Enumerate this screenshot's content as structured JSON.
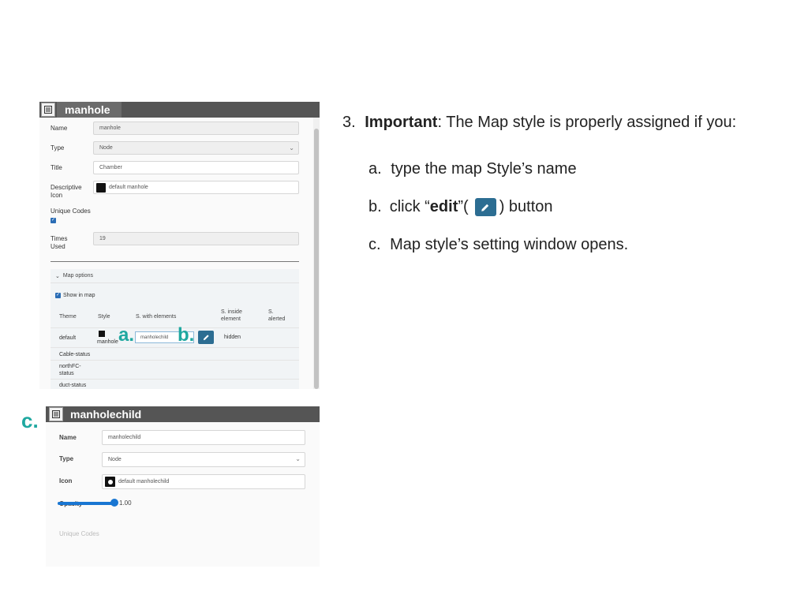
{
  "panel1": {
    "title": "manhole",
    "fields": {
      "name_label": "Name",
      "name_value": "manhole",
      "type_label": "Type",
      "type_value": "Node",
      "title_label": "Title",
      "title_value": "Chamber",
      "desc_icon_label_1": "Descriptive",
      "desc_icon_label_2": "Icon",
      "desc_icon_value": "default manhole",
      "unique_codes_label": "Unique Codes",
      "times_used_label_1": "Times",
      "times_used_label_2": "Used",
      "times_used_value": "19"
    },
    "map_options": {
      "header": "Map options",
      "show_in_map": "Show in map",
      "columns": {
        "theme": "Theme",
        "style": "Style",
        "with_elements": "S. with elements",
        "inside_1": "S. inside",
        "inside_2": "element",
        "alerted_1": "S.",
        "alerted_2": "alerted"
      },
      "default_row": {
        "theme": "default",
        "style": "manhole",
        "input_value": "manholechild",
        "inside": "hidden"
      },
      "rows": [
        "Cable-status",
        "northFC-",
        "status",
        "duct-status"
      ]
    }
  },
  "markers": {
    "a": "a.",
    "b": "b.",
    "c": "c."
  },
  "panel2": {
    "title": "manholechild",
    "name_label": "Name",
    "name_value": "manholechild",
    "type_label": "Type",
    "type_value": "Node",
    "icon_label": "Icon",
    "icon_value": "default manholechild",
    "opacity_label": "Opacity",
    "opacity_value": "1.00",
    "ghost_unique": "Unique Codes"
  },
  "instructions": {
    "number": "3.",
    "important": "Important",
    "intro_rest": ": The Map style is properly assigned if you:",
    "a_marker": "a.",
    "a_text": "type the map Style’s name",
    "b_marker": "b.",
    "b_text_1": "click “",
    "b_bold": "edit",
    "b_text_2": "”(",
    "b_text_3": ") button",
    "c_marker": "c.",
    "c_text": "Map style’s setting window opens."
  },
  "colors": {
    "accent_teal": "#1fa8a0",
    "edit_blue": "#2c6d92",
    "header_gray": "#555555",
    "slider_blue": "#1976d2"
  }
}
